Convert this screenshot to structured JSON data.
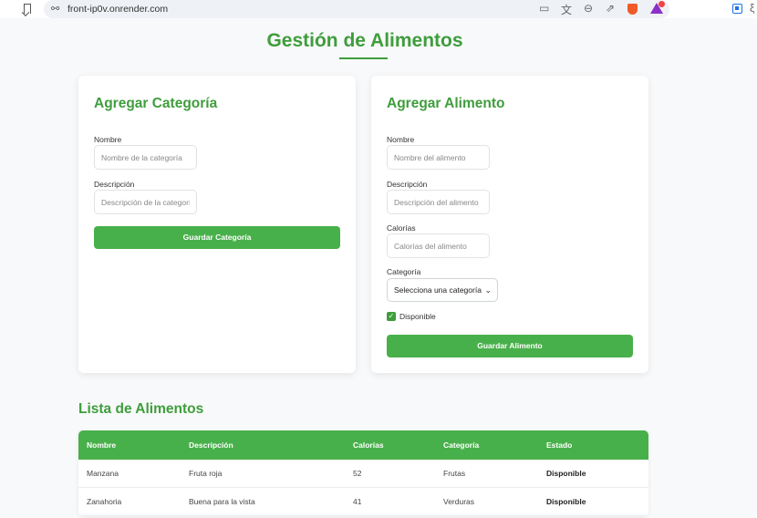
{
  "browser": {
    "url": "front-ip0v.onrender.com"
  },
  "page": {
    "title": "Gestión de Alimentos",
    "accent_color": "#3f9d3c",
    "button_color": "#48b04a"
  },
  "category_form": {
    "title": "Agregar Categoría",
    "name_label": "Nombre",
    "name_placeholder": "Nombre de la categoría",
    "description_label": "Descripción",
    "description_placeholder": "Descripción de la categoría",
    "submit_label": "Guardar Categoría"
  },
  "food_form": {
    "title": "Agregar Alimento",
    "name_label": "Nombre",
    "name_placeholder": "Nombre del alimento",
    "description_label": "Descripción",
    "description_placeholder": "Descripción del alimento",
    "calories_label": "Calorías",
    "calories_placeholder": "Calorías del alimento",
    "category_label": "Categoría",
    "category_selected": "Selecciona una categoría",
    "available_label": "Disponible",
    "available_checked": true,
    "submit_label": "Guardar Alimento"
  },
  "food_list": {
    "title": "Lista de Alimentos",
    "columns": [
      "Nombre",
      "Descripción",
      "Calorías",
      "Categoría",
      "Estado"
    ],
    "rows": [
      [
        "Manzana",
        "Fruta roja",
        "52",
        "Frutas",
        "Disponible"
      ],
      [
        "Zanahoria",
        "Buena para la vista",
        "41",
        "Verduras",
        "Disponible"
      ]
    ]
  }
}
